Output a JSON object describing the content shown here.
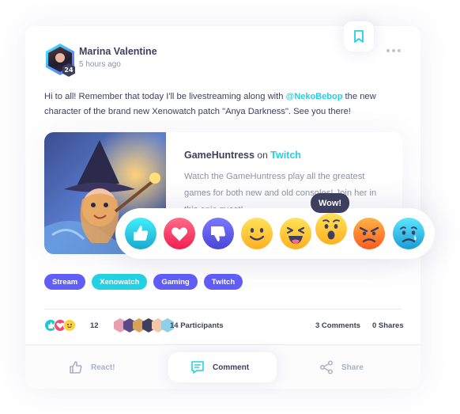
{
  "colors": {
    "cyan": "#23d2e2",
    "purple": "#615dfa",
    "dark": "#3e3f5e",
    "muted": "#8f91ac"
  },
  "post": {
    "author_name": "Marina Valentine",
    "author_level": "24",
    "timestamp": "5 hours ago",
    "text_before": "Hi to all! Remember that today I'll be livestreaming along with ",
    "mention": "@NekoBebop",
    "text_after": " the new character of the brand new Xenowatch patch \"Anya Darkness\". See you there!"
  },
  "preview": {
    "title": "GameHuntress",
    "on_word": "on",
    "platform": "Twitch",
    "description": "Watch the GameHuntress play all the greatest games for both new and old consoles! Join her in this epic quest!"
  },
  "reactions": {
    "tooltip": "Wow!",
    "items": [
      "like-icon",
      "love-icon",
      "dislike-icon",
      "happy-icon",
      "funny-icon",
      "wow-icon",
      "angry-icon",
      "sad-icon"
    ]
  },
  "tags": [
    "Stream",
    "Xenowatch",
    "Gaming",
    "Twitch"
  ],
  "stats": {
    "reaction_count": "12",
    "participants": "14 Participants",
    "comments": "3 Comments",
    "shares": "0 Shares"
  },
  "actions": {
    "react": "React!",
    "comment": "Comment",
    "share": "Share"
  }
}
